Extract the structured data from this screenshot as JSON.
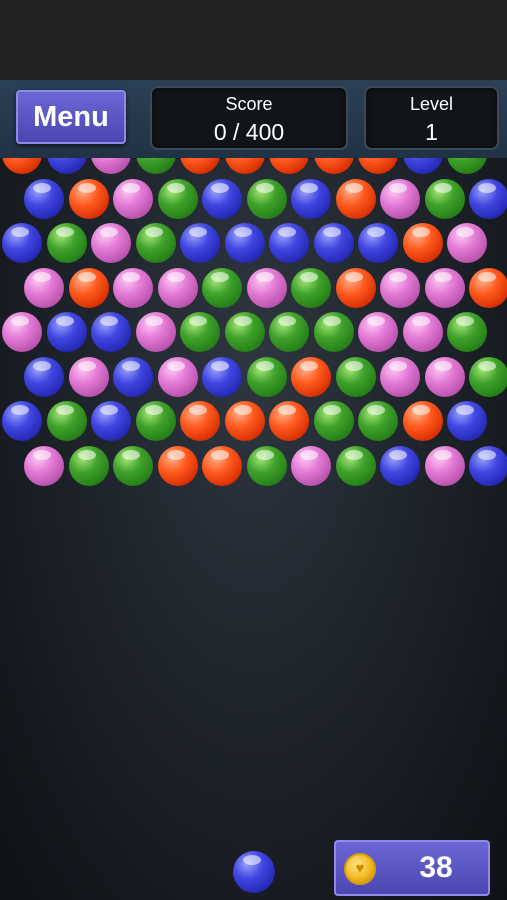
{
  "header": {
    "menu_label": "Menu",
    "score_label": "Score",
    "score_value": "0 / 400",
    "level_label": "Level",
    "level_value": "1"
  },
  "board": {
    "rows": [
      [
        "orange",
        "blue",
        "pink",
        "green",
        "orange",
        "orange",
        "orange",
        "orange",
        "orange",
        "blue",
        "green"
      ],
      [
        "blue",
        "orange",
        "pink",
        "green",
        "blue",
        "green",
        "blue",
        "orange",
        "pink",
        "green",
        "blue"
      ],
      [
        "blue",
        "green",
        "pink",
        "green",
        "blue",
        "blue",
        "blue",
        "blue",
        "blue",
        "orange",
        "pink"
      ],
      [
        "pink",
        "orange",
        "pink",
        "pink",
        "green",
        "pink",
        "green",
        "orange",
        "pink",
        "pink",
        "orange"
      ],
      [
        "pink",
        "blue",
        "blue",
        "pink",
        "green",
        "green",
        "green",
        "green",
        "pink",
        "pink",
        "green"
      ],
      [
        "blue",
        "pink",
        "blue",
        "pink",
        "blue",
        "green",
        "orange",
        "green",
        "pink",
        "pink",
        "green"
      ],
      [
        "blue",
        "green",
        "blue",
        "green",
        "orange",
        "orange",
        "orange",
        "green",
        "green",
        "orange",
        "blue"
      ],
      [
        "pink",
        "green",
        "green",
        "orange",
        "orange",
        "green",
        "pink",
        "green",
        "blue",
        "pink",
        "blue"
      ]
    ]
  },
  "shooter": {
    "color": "blue"
  },
  "coins": {
    "icon": "heart-coin-icon",
    "count": "38"
  },
  "colors": {
    "orange": "#ff5a1e",
    "blue": "#4046e0",
    "pink": "#e37ad6",
    "green": "#3fa22a",
    "menu_button": "#5b56c8",
    "header": "#263a4e"
  }
}
